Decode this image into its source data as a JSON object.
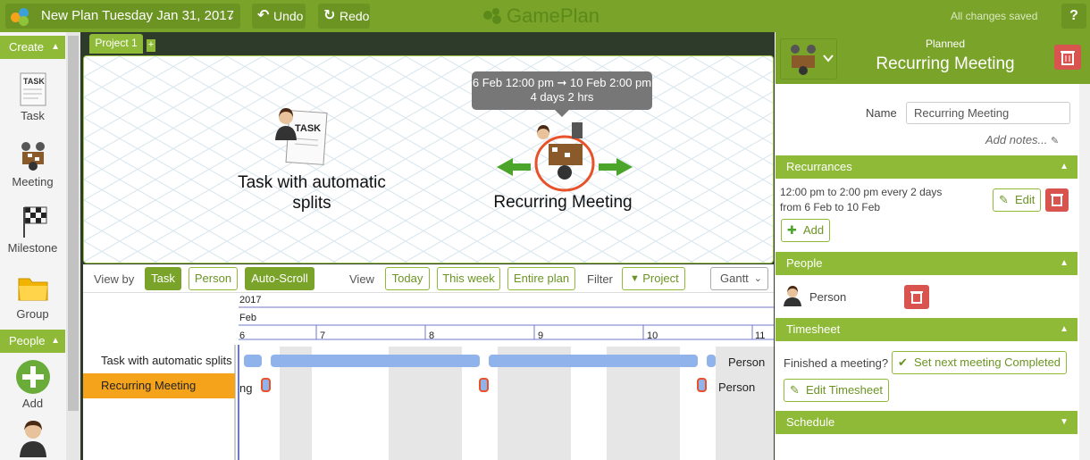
{
  "topbar": {
    "plan_title": "New Plan Tuesday Jan 31, 2017",
    "undo_label": "Undo",
    "redo_label": "Redo",
    "brand": "GamePlan",
    "status": "All changes saved",
    "help_label": "?"
  },
  "left": {
    "create_header": "Create",
    "tools": [
      {
        "label": "Task",
        "icon": "task-icon"
      },
      {
        "label": "Meeting",
        "icon": "meeting-icon"
      },
      {
        "label": "Milestone",
        "icon": "milestone-icon"
      },
      {
        "label": "Group",
        "icon": "folder-icon"
      }
    ],
    "people_header": "People",
    "add_label": "Add"
  },
  "tabs": {
    "active": "Project 1",
    "add": "+"
  },
  "canvas": {
    "nodes": [
      {
        "label": "Task with automatic splits"
      },
      {
        "label": "Recurring Meeting"
      }
    ],
    "tooltip_range": "6 Feb 12:00 pm ➞ 10 Feb 2:00 pm",
    "tooltip_duration": "4 days 2 hrs",
    "task_sheet_text": "TASK"
  },
  "gantt": {
    "view_by_label": "View by",
    "view_by": [
      "Task",
      "Person"
    ],
    "auto_scroll": "Auto-Scroll",
    "view_label": "View",
    "views": [
      "Today",
      "This week",
      "Entire plan"
    ],
    "filter_label": "Filter",
    "filter_btn": "Project",
    "mode": "Gantt",
    "year": "2017",
    "month": "Feb",
    "days": [
      "6",
      "7",
      "8",
      "9",
      "10",
      "11"
    ],
    "rows": [
      {
        "name": "Task with automatic splits",
        "person": "Person"
      },
      {
        "name": "Recurring Meeting",
        "person": "Person",
        "trail": "ng"
      }
    ]
  },
  "right": {
    "status": "Planned",
    "title": "Recurring Meeting",
    "name_label": "Name",
    "name_value": "Recurring Meeting",
    "add_notes": "Add notes...",
    "recurrances_header": "Recurrances",
    "recurrence_line1": "12:00 pm to 2:00 pm every 2 days",
    "recurrence_line2": "from 6 Feb to 10 Feb",
    "edit_label": "Edit",
    "add_label": "Add",
    "people_header": "People",
    "person_name": "Person",
    "timesheet_header": "Timesheet",
    "finished_text": "Finished a meeting?",
    "set_next_label": "Set next meeting Completed",
    "edit_timesheet_label": "Edit Timesheet",
    "schedule_header": "Schedule"
  },
  "colors": {
    "brand_green": "#7aa32a",
    "section_green": "#8fba37",
    "selected_row": "#f5a31a",
    "bar_blue": "#8fb3ea",
    "delete_red": "#d9534f"
  }
}
